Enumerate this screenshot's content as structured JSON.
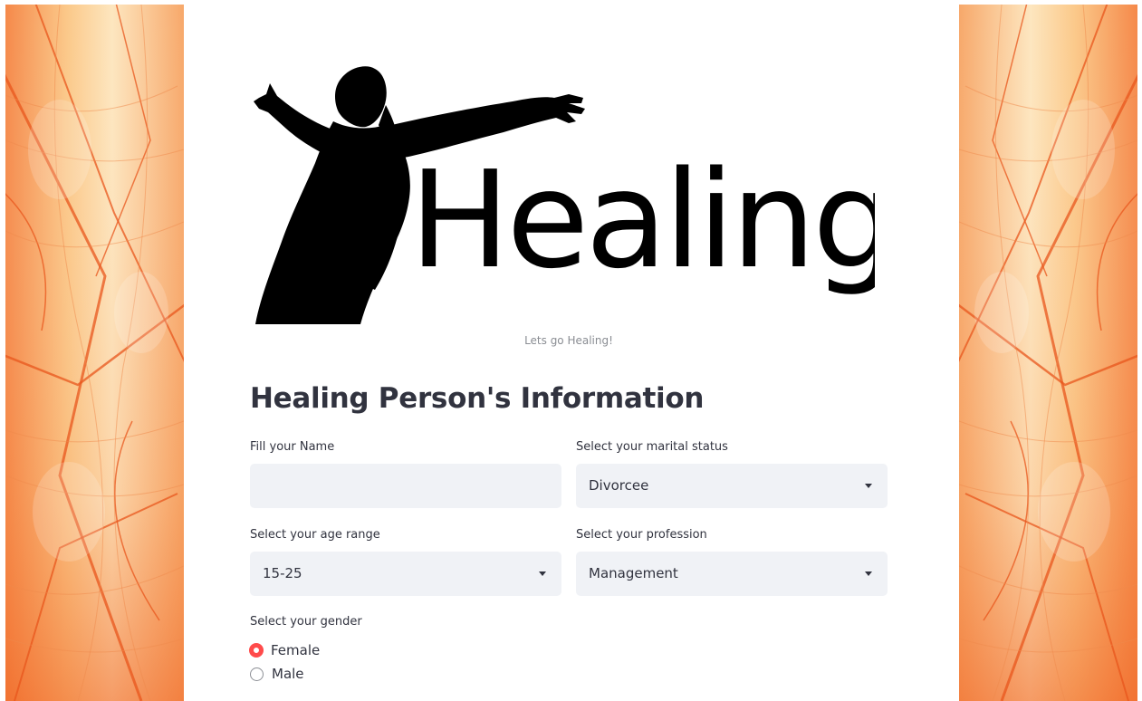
{
  "banner": {
    "logo_text": "Healing",
    "caption": "Lets go Healing!"
  },
  "form": {
    "title": "Healing Person's Information",
    "name_field": {
      "label": "Fill your Name",
      "value": ""
    },
    "marital_status": {
      "label": "Select your marital status",
      "selected": "Divorcee"
    },
    "age_range": {
      "label": "Select your age range",
      "selected": "15-25"
    },
    "profession": {
      "label": "Select your profession",
      "selected": "Management"
    },
    "gender": {
      "label": "Select your gender",
      "options": [
        {
          "label": "Female",
          "selected": true
        },
        {
          "label": "Male",
          "selected": false
        }
      ]
    }
  },
  "colors": {
    "accent": "#ff4b4b",
    "input_bg": "#f0f2f6",
    "text": "#31333f",
    "caption": "#8a8d93",
    "leaf_orange": "#f26a2a",
    "leaf_cream": "#fbe3b4"
  },
  "icons": {
    "select_caret": "caret-down-icon",
    "silhouette": "woman-silhouette-icon",
    "background": "leaf-pattern-image"
  }
}
